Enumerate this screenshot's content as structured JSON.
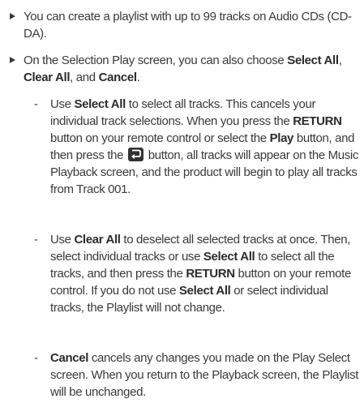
{
  "bullets": [
    {
      "text": "You can create a playlist with up to 99 tracks on Audio CDs (CD-DA)."
    },
    {
      "t1": "On the Selection Play screen, you can also choose ",
      "b1": "Select All",
      "t2": ", ",
      "b2": "Clear All",
      "t3": ", and ",
      "b3": "Cancel",
      "t4": "."
    }
  ],
  "subitems": [
    {
      "dash": "-",
      "t1": "Use ",
      "b1": "Select All",
      "t2": " to select all tracks. This cancels your individual track selections. When you press the ",
      "b2": "RETURN",
      "t3": " button on your remote control or select the ",
      "b3": "Play",
      "t4": " button, and then press the ",
      "icon": "return-button-icon",
      "t5": " button, all tracks will appear on the Music Playback screen, and the product will begin to play all tracks from Track 001."
    },
    {
      "dash": "-",
      "t1": "Use ",
      "b1": "Clear All",
      "t2": " to deselect all selected tracks at once. Then, select individual tracks or use ",
      "b2": "Select All",
      "t3": " to select all the tracks, and then press the ",
      "b3": "RETURN",
      "t4": " button on your remote control. If you do not use ",
      "b4": "Select All",
      "t5": " or select individual tracks, the Playlist will not change."
    },
    {
      "dash": "-",
      "b1": "Cancel",
      "t1": " cancels any changes you made on the Play Select screen. When you return to the Playback screen, the Playlist will be unchanged."
    }
  ]
}
